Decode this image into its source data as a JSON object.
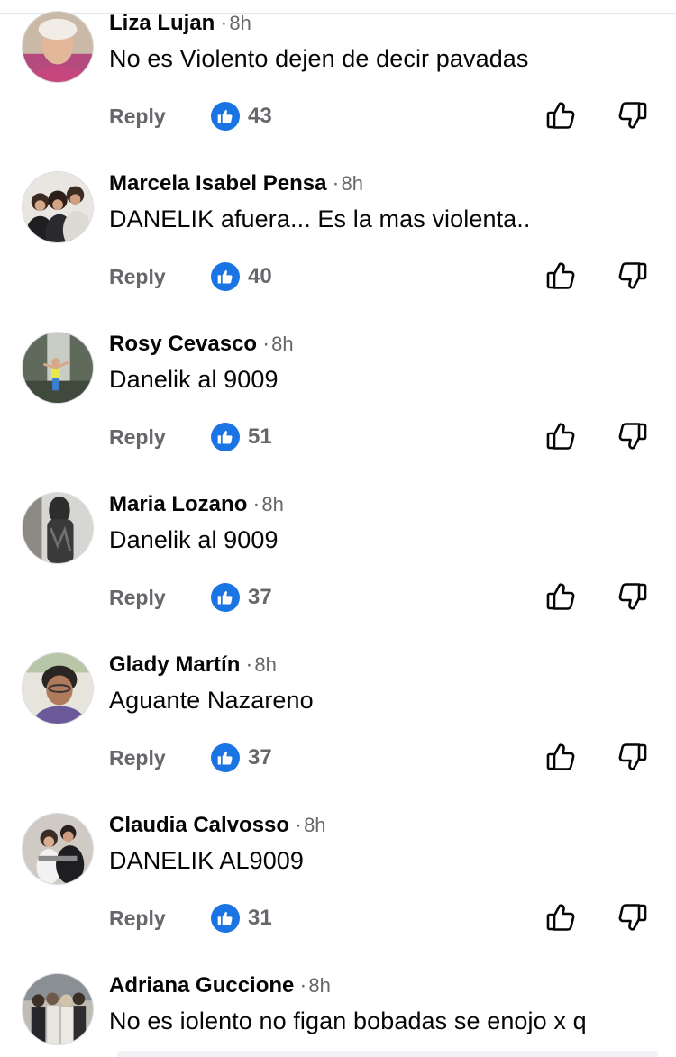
{
  "dot": "·",
  "reply_label": "Reply",
  "colors": {
    "like_blue": "#1b74e4",
    "meta_gray": "#65676b",
    "text": "#050505"
  },
  "comments": [
    {
      "author": "Liza Lujan",
      "time": "8h",
      "text": "No es Violento dejen de decir pavadas",
      "likes": "43"
    },
    {
      "author": "Marcela Isabel Pensa",
      "time": "8h",
      "text": "DANELIK afuera... Es la mas violenta..",
      "likes": "40"
    },
    {
      "author": "Rosy Cevasco",
      "time": "8h",
      "text": "Danelik al 9009",
      "likes": "51"
    },
    {
      "author": "Maria Lozano",
      "time": "8h",
      "text": "Danelik al 9009",
      "likes": "37"
    },
    {
      "author": "Glady Martín",
      "time": "8h",
      "text": "Aguante Nazareno",
      "likes": "37"
    },
    {
      "author": "Claudia Calvosso",
      "time": "8h",
      "text": "DANELIK AL9009",
      "likes": "31"
    },
    {
      "author": "Adriana Guccione",
      "time": "8h",
      "text": "No es  iolento no figan bobadas se enojo x q"
    }
  ]
}
